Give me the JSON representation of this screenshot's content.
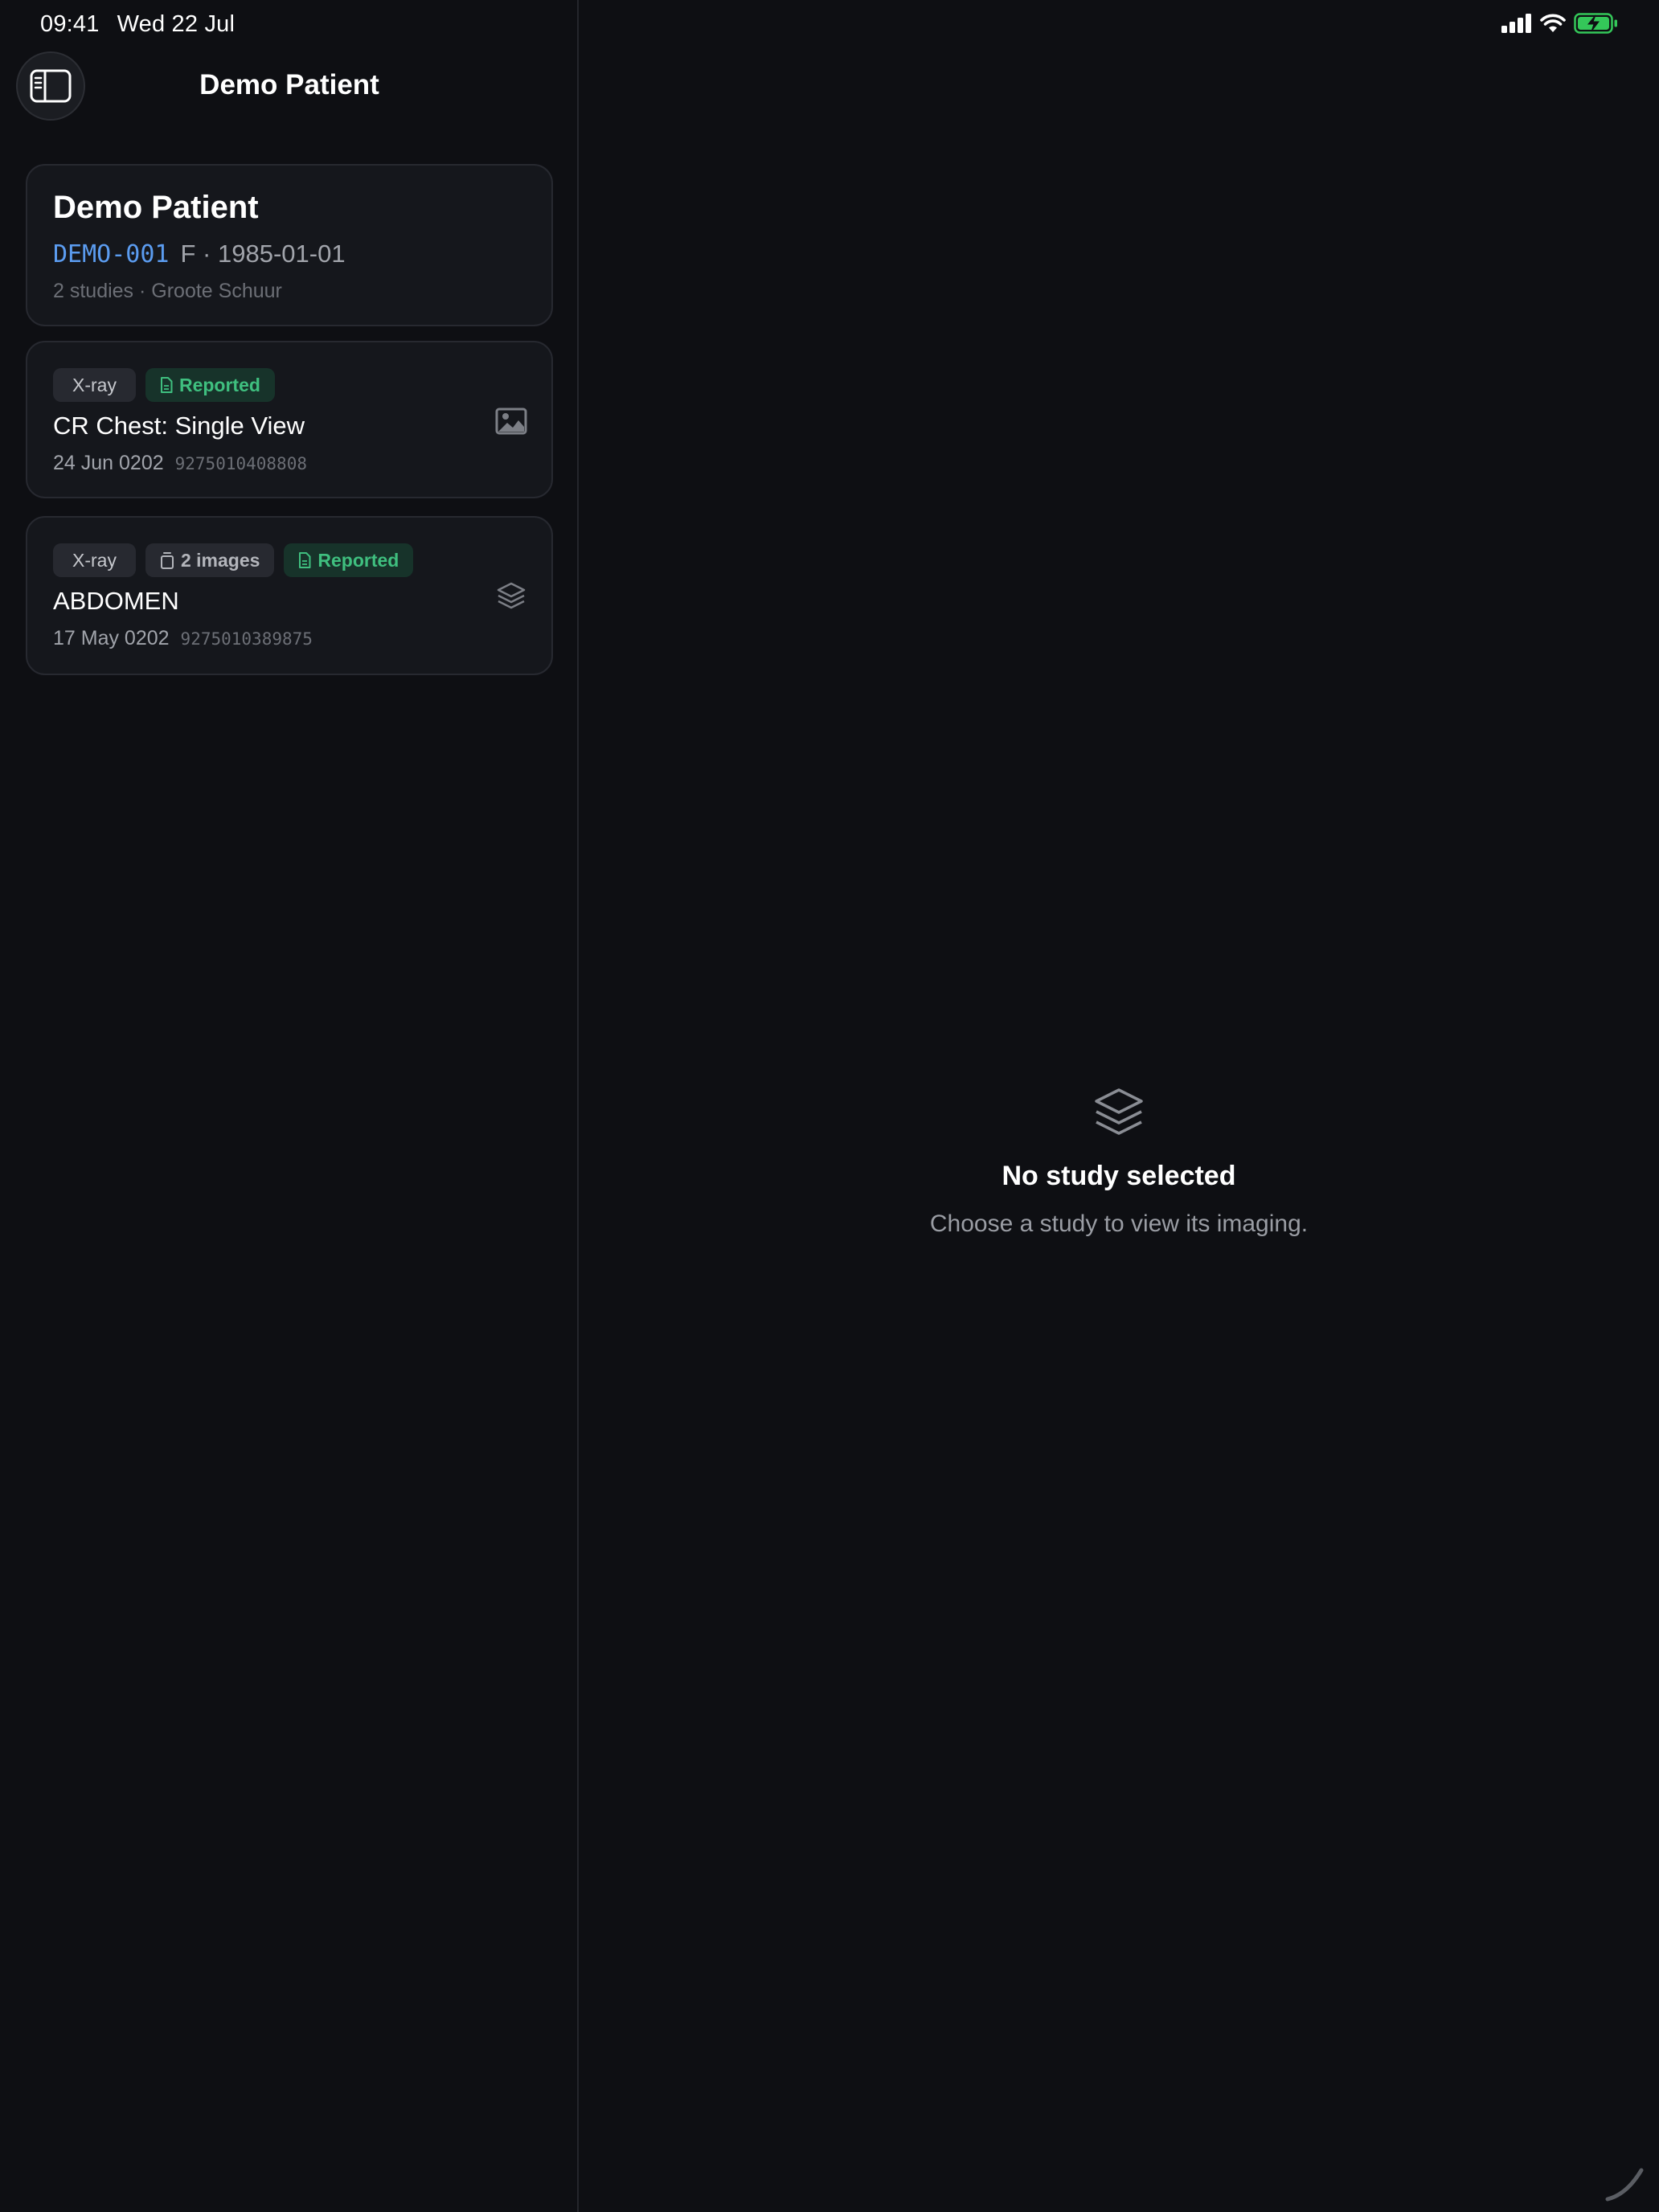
{
  "status_bar": {
    "time": "09:41",
    "date": "Wed 22 Jul",
    "icons": [
      "cellular-signal-icon",
      "wifi-icon",
      "battery-charging-icon"
    ],
    "battery_color": "#34c759"
  },
  "nav": {
    "title": "Demo Patient",
    "toggle_icon": "sidebar-toggle-icon"
  },
  "patient": {
    "name": "Demo Patient",
    "mrn": "DEMO-001",
    "sex_dob": "F · 1985-01-01",
    "meta": "2 studies · Groote Schuur"
  },
  "studies": [
    {
      "modality": "X-ray",
      "status": "Reported",
      "title": "CR Chest: Single View",
      "date": "24 Jun 0202",
      "accession": "9275010408808",
      "thumb_icon": "image-icon"
    },
    {
      "modality": "X-ray",
      "image_count": "2 images",
      "status": "Reported",
      "title": "ABDOMEN",
      "date": "17 May 0202",
      "accession": "9275010389875",
      "thumb_icon": "stack-icon"
    }
  ],
  "detail": {
    "empty_title": "No study selected",
    "empty_subtitle": "Choose a study to view its imaging.",
    "empty_icon": "layers-icon"
  },
  "colors": {
    "background": "#0e0f13",
    "card": "#15171c",
    "accent_blue": "#5b9cf0",
    "reported_green": "#3fbf7f"
  }
}
